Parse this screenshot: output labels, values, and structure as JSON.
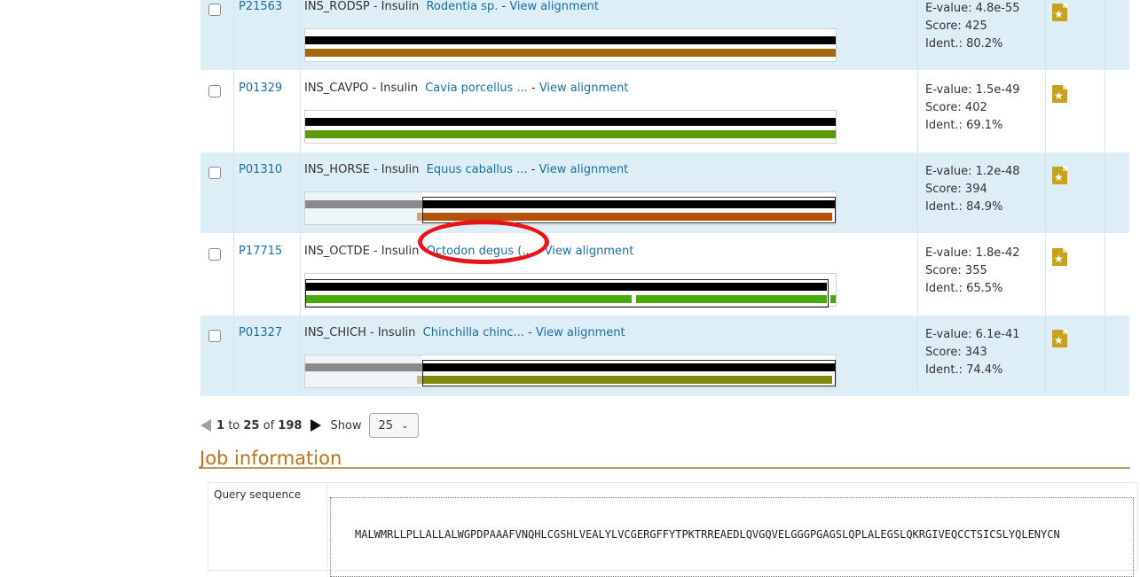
{
  "rows": [
    {
      "accession": "P21563",
      "entry": "INS_RODSP",
      "protein": "Insulin",
      "organism": "Rodentia sp.",
      "view": "View alignment",
      "evalue": "E-value: 4.8e-55",
      "score": "Score: 425",
      "ident": "Ident.: 80.2%",
      "bar_color": "#a26a0a"
    },
    {
      "accession": "P01329",
      "entry": "INS_CAVPO",
      "protein": "Insulin",
      "organism": "Cavia porcellus ...",
      "view": "View alignment",
      "evalue": "E-value: 1.5e-49",
      "score": "Score: 402",
      "ident": "Ident.: 69.1%",
      "bar_color": "#5c9a0a"
    },
    {
      "accession": "P01310",
      "entry": "INS_HORSE",
      "protein": "Insulin",
      "organism": "Equus caballus ...",
      "view": "View alignment",
      "evalue": "E-value: 1.2e-48",
      "score": "Score: 394",
      "ident": "Ident.: 84.9%",
      "bar_color": "#b5520a"
    },
    {
      "accession": "P17715",
      "entry": "INS_OCTDE",
      "protein": "Insulin",
      "organism": "Octodon degus (...",
      "view": "View alignment",
      "evalue": "E-value: 1.8e-42",
      "score": "Score: 355",
      "ident": "Ident.: 65.5%",
      "bar_color": "#49a90a"
    },
    {
      "accession": "P01327",
      "entry": "INS_CHICH",
      "protein": "Insulin",
      "organism": "Chinchilla chinc...",
      "view": "View alignment",
      "evalue": "E-value: 6.1e-41",
      "score": "Score: 343",
      "ident": "Ident.: 74.4%",
      "bar_color": "#7f8a0a"
    }
  ],
  "pager": {
    "from": "1",
    "to_word": "to",
    "to": "25",
    "of_word": "of",
    "total": "198",
    "show_label": "Show",
    "page_size": "25"
  },
  "job_section": {
    "title": "Job information",
    "query_label": "Query sequence",
    "sequence": "MALWMRLLPLLALLALWGPDPAAAFVNQHLCGSHLVEALYLVCGERGFFYTPKTRREAEDLQVGQVELGGGPGAGSLQPLALEGSLQKRGIVEQCCTSICSLYQLENYCN"
  },
  "colors": {
    "row_blue": "#deeef6",
    "link": "#1a6fa0",
    "section_title": "#b5751a",
    "annotation": "#e8141a"
  }
}
